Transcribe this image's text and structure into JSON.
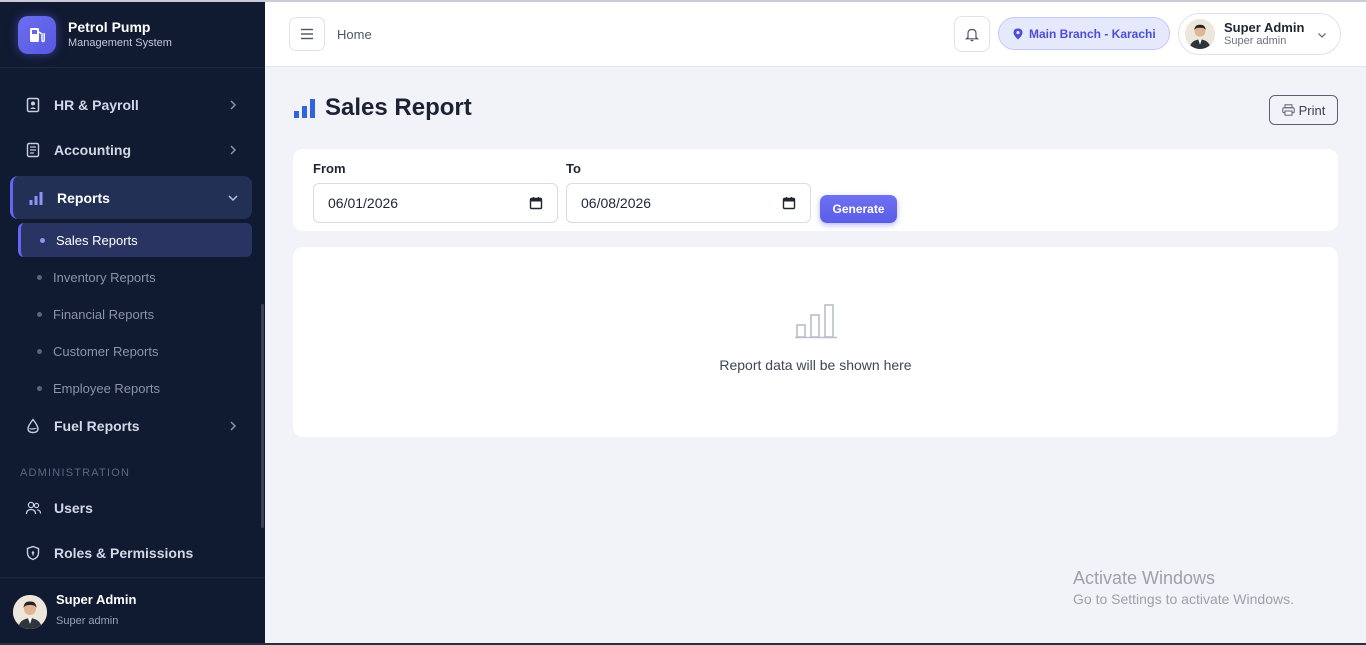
{
  "brand": {
    "title": "Petrol Pump",
    "subtitle": "Management System",
    "logo_icon": "fuel-pump-icon",
    "accent": "#6366f1"
  },
  "sidebar": {
    "items": [
      {
        "label": "HR & Payroll",
        "icon": "id-badge-icon"
      },
      {
        "label": "Accounting",
        "icon": "ledger-icon"
      },
      {
        "label": "Reports",
        "icon": "bar-chart-icon",
        "expanded": true
      },
      {
        "label": "Fuel Reports",
        "icon": "fuel-drop-icon"
      }
    ],
    "sub_items": [
      {
        "label": "Sales Reports",
        "active": true
      },
      {
        "label": "Inventory Reports"
      },
      {
        "label": "Financial Reports"
      },
      {
        "label": "Customer Reports"
      },
      {
        "label": "Employee Reports"
      }
    ],
    "admin_section_label": "ADMINISTRATION",
    "admin_items": [
      {
        "label": "Users",
        "icon": "users-icon"
      },
      {
        "label": "Roles & Permissions",
        "icon": "shield-icon"
      }
    ],
    "user": {
      "name": "Super Admin",
      "role": "Super admin"
    }
  },
  "topbar": {
    "breadcrumb": "Home",
    "branch": "Main Branch - Karachi",
    "user": {
      "name": "Super Admin",
      "role": "Super admin"
    }
  },
  "page": {
    "title": "Sales Report",
    "print_label": "Print",
    "from_label": "From",
    "from_value": "06/01/2026",
    "to_label": "To",
    "to_value": "06/08/2026",
    "generate_label": "Generate",
    "empty_text": "Report data will be shown here"
  },
  "watermark": {
    "line1": "Activate Windows",
    "line2": "Go to Settings to activate Windows."
  }
}
